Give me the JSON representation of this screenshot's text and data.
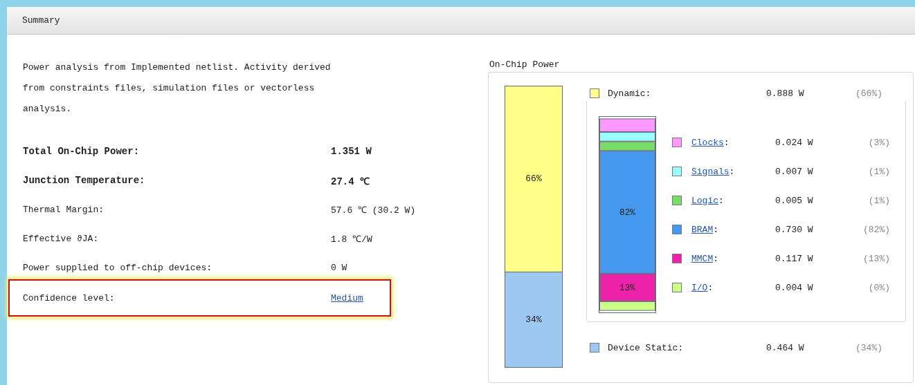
{
  "panel": {
    "title": "Summary"
  },
  "description": "Power analysis from Implemented netlist. Activity derived from constraints files, simulation files or vectorless analysis.",
  "metrics": [
    {
      "label": "Total On-Chip Power:",
      "value": "1.351 W",
      "emphasized": true,
      "kind": "text",
      "highlighted": false
    },
    {
      "label": "Junction Temperature:",
      "value": "27.4 ℃",
      "emphasized": true,
      "kind": "text",
      "highlighted": false
    },
    {
      "label": "Thermal Margin:",
      "value": "57.6 ℃ (30.2 W)",
      "emphasized": false,
      "kind": "text",
      "highlighted": false
    },
    {
      "label": "Effective ϑJA:",
      "value": "1.8 ℃/W",
      "emphasized": false,
      "kind": "text",
      "highlighted": false
    },
    {
      "label": "Power supplied to off-chip devices:",
      "value": "0 W",
      "emphasized": false,
      "kind": "text",
      "highlighted": false
    },
    {
      "label": "Confidence level:",
      "value": "Medium",
      "emphasized": false,
      "kind": "link",
      "highlighted": true
    }
  ],
  "on_chip_power": {
    "title": "On-Chip Power",
    "summary_bar": [
      {
        "label": "66%",
        "level": 0.66,
        "color": "#ffff88"
      },
      {
        "label": "34%",
        "level": 0.34,
        "color": "#9cc8f2"
      }
    ],
    "dynamic": {
      "name": "Dynamic:",
      "value": "0.888 W",
      "percent": "(66%)",
      "color": "#ffff88"
    },
    "dynamic_bar": [
      {
        "color": "#ff99ff"
      },
      {
        "color": "#99ffff"
      },
      {
        "color": "#77dd66"
      },
      {
        "label": "82%",
        "color": "#4499ee"
      },
      {
        "label": "13%",
        "color": "#ee22aa"
      },
      {
        "color": "#ccff88"
      }
    ],
    "breakdown": [
      {
        "name": "Clocks",
        "suffix": ":",
        "value": "0.024 W",
        "percent": "(3%)",
        "color": "#ff99ff"
      },
      {
        "name": "Signals",
        "suffix": ":",
        "value": "0.007 W",
        "percent": "(1%)",
        "color": "#99ffff"
      },
      {
        "name": "Logic",
        "suffix": ":",
        "value": "0.005 W",
        "percent": "(1%)",
        "color": "#77dd66"
      },
      {
        "name": "BRAM",
        "suffix": ":",
        "value": "0.730 W",
        "percent": "(82%)",
        "color": "#4499ee"
      },
      {
        "name": "MMCM",
        "suffix": ":",
        "value": "0.117 W",
        "percent": "(13%)",
        "color": "#ee22aa"
      },
      {
        "name": "I/O",
        "suffix": ":",
        "value": "0.004 W",
        "percent": "(0%)",
        "color": "#ccff88"
      }
    ],
    "static": {
      "name": "Device Static:",
      "value": "0.464 W",
      "percent": "(34%)",
      "color": "#9cc8f2"
    }
  }
}
